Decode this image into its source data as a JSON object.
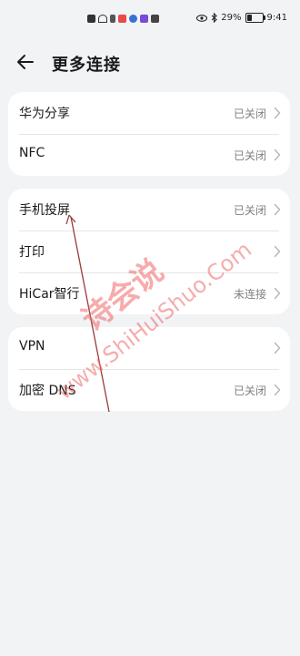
{
  "status_bar": {
    "battery": "29%",
    "time": "9:41",
    "battery_level": 0.29
  },
  "header": {
    "title": "更多连接"
  },
  "groups": [
    {
      "rows": [
        {
          "label": "华为分享",
          "status": "已关闭"
        },
        {
          "label": "NFC",
          "status": "已关闭"
        }
      ]
    },
    {
      "rows": [
        {
          "label": "手机投屏",
          "status": "已关闭"
        },
        {
          "label": "打印",
          "status": ""
        },
        {
          "label": "HiCar智行",
          "status": "未连接"
        }
      ]
    },
    {
      "rows": [
        {
          "label": "VPN",
          "status": ""
        },
        {
          "label": "加密 DNS",
          "status": "已关闭"
        }
      ]
    }
  ],
  "watermark": {
    "cn": "诗会说",
    "en": "www.ShiHuiShuo.Com"
  },
  "colors": {
    "background": "#f1f3f5",
    "card": "#ffffff",
    "watermark": "#f06a6a"
  }
}
